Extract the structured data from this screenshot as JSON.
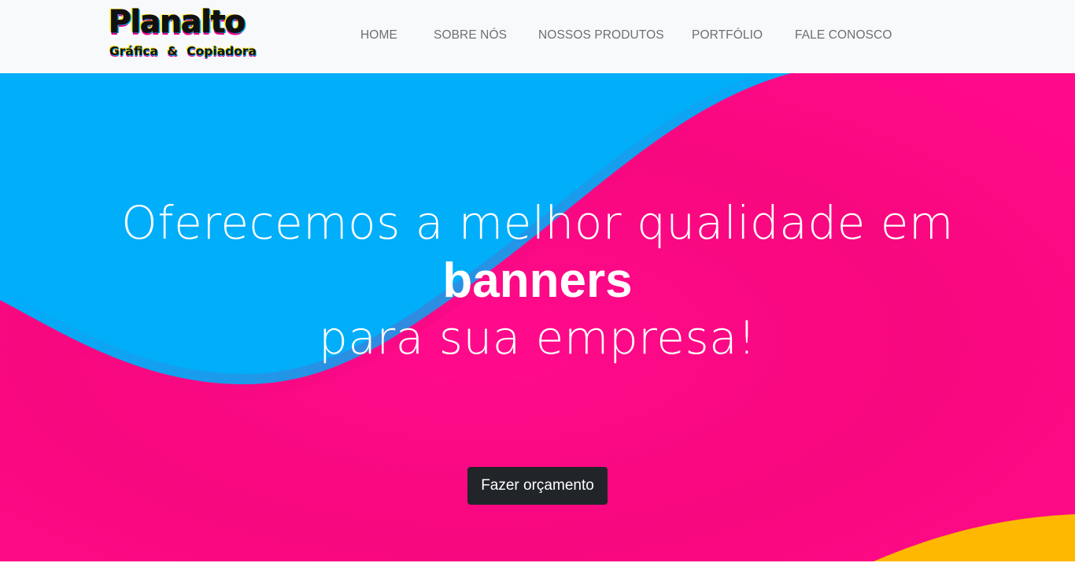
{
  "brand": {
    "name": "Planalto",
    "tagline": "Gráfica & Copiadora"
  },
  "nav": {
    "items": [
      "HOME",
      "SOBRE NÓS",
      "NOSSOS PRODUTOS",
      "PORTFÓLIO",
      "FALE CONOSCO"
    ]
  },
  "hero": {
    "line1": "Oferecemos a melhor qualidade em",
    "highlight": "banners",
    "line3": "para sua empresa!",
    "cta_label": "Fazer orçamento"
  },
  "colors": {
    "cyan": "#00aefa",
    "magenta": "#ff0a8a",
    "yellow": "#ffb800",
    "button": "#212529",
    "nav_text": "#6c6f73"
  }
}
